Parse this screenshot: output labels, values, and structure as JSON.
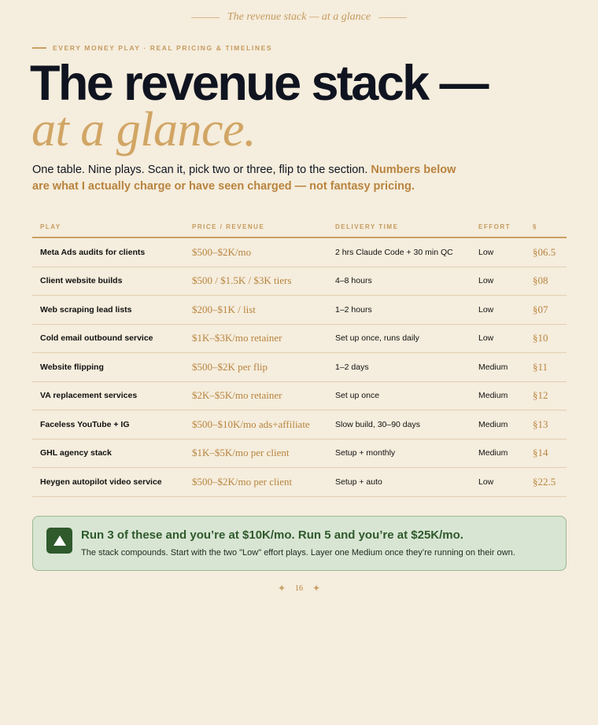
{
  "running_head": "The revenue stack — at a glance",
  "eyebrow": "EVERY MONEY PLAY · REAL PRICING & TIMELINES",
  "headline": {
    "line1": "The revenue stack —",
    "line2": "at a glance."
  },
  "lede": {
    "plain": "One table. Nine plays. Scan it, pick two or three, flip to the section. ",
    "accent": "Numbers below are what I actually charge or have seen charged — not fantasy pricing."
  },
  "table": {
    "headers": [
      "PLAY",
      "PRICE / REVENUE",
      "DELIVERY TIME",
      "EFFORT",
      "§"
    ],
    "rows": [
      {
        "play": "Meta Ads audits for clients",
        "price": "$500–$2K/mo",
        "delivery": "2 hrs Claude Code + 30 min QC",
        "effort": "Low",
        "section": "§06.5"
      },
      {
        "play": "Client website builds",
        "price": "$500 / $1.5K / $3K tiers",
        "delivery": "4–8 hours",
        "effort": "Low",
        "section": "§08"
      },
      {
        "play": "Web scraping lead lists",
        "price": "$200–$1K / list",
        "delivery": "1–2 hours",
        "effort": "Low",
        "section": "§07"
      },
      {
        "play": "Cold email outbound service",
        "price": "$1K–$3K/mo retainer",
        "delivery": "Set up once, runs daily",
        "effort": "Low",
        "section": "§10"
      },
      {
        "play": "Website flipping",
        "price": "$500–$2K per flip",
        "delivery": "1–2 days",
        "effort": "Medium",
        "section": "§11"
      },
      {
        "play": "VA replacement services",
        "price": "$2K–$5K/mo retainer",
        "delivery": "Set up once",
        "effort": "Medium",
        "section": "§12"
      },
      {
        "play": "Faceless YouTube + IG",
        "price": "$500–$10K/mo ads+affiliate",
        "delivery": "Slow build, 30–90 days",
        "effort": "Medium",
        "section": "§13"
      },
      {
        "play": "GHL agency stack",
        "price": "$1K–$5K/mo per client",
        "delivery": "Setup + monthly",
        "effort": "Medium",
        "section": "§14"
      },
      {
        "play": "Heygen autopilot video service",
        "price": "$500–$2K/mo per client",
        "delivery": "Setup + auto",
        "effort": "Low",
        "section": "§22.5"
      }
    ]
  },
  "callout": {
    "icon": "triangle-up-icon",
    "title": "Run 3 of these and you’re at $10K/mo. Run 5 and you’re at $25K/mo.",
    "body": "The stack compounds. Start with the two \"Low\" effort plays. Layer one Medium once they’re running on their own."
  },
  "folio": {
    "page_number": "16",
    "ornament": "✦"
  },
  "colors": {
    "background": "#f5eddd",
    "gold": "#c9a063",
    "ink": "#0f1420",
    "callout_bg": "#d8e5d3",
    "callout_green": "#2f5a2c"
  }
}
